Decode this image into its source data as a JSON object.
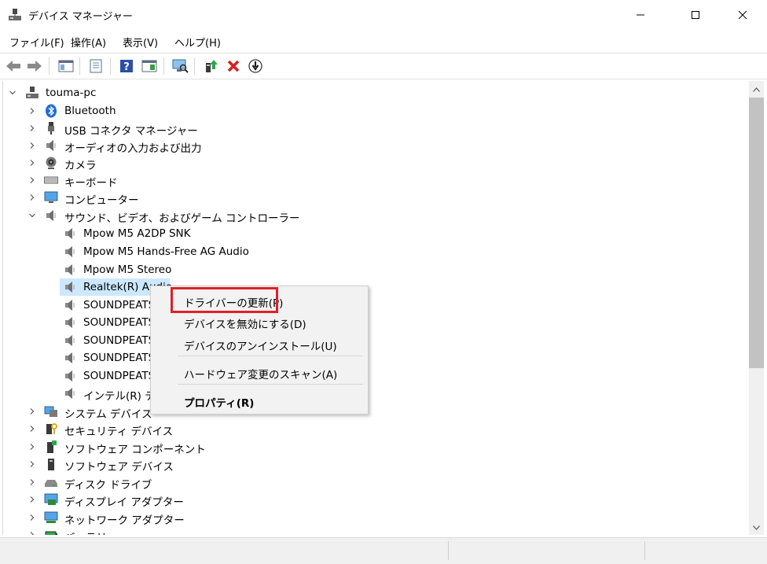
{
  "window": {
    "title": "デバイス マネージャー"
  },
  "menu": [
    "ファイル(F)",
    "操作(A)",
    "表示(V)",
    "ヘルプ(H)"
  ],
  "toolbar_icons": [
    "back-icon",
    "forward-icon",
    "show-hide-console-tree-icon",
    "properties-icon",
    "help-icon",
    "action-pane-icon",
    "scan-hardware-icon",
    "update-driver-icon",
    "uninstall-device-icon",
    "disable-device-icon"
  ],
  "tree": {
    "root": "touma-pc",
    "categories": [
      "Bluetooth",
      "USB コネクタ マネージャー",
      "オーディオの入力および出力",
      "カメラ",
      "キーボード",
      "コンピューター",
      "サウンド、ビデオ、およびゲーム コントローラー"
    ],
    "sound_children": [
      "Mpow M5 A2DP SNK",
      "Mpow M5 Hands-Free AG Audio",
      "Mpow M5 Stereo",
      "Realtek(R) Audio",
      "SOUNDPEATS",
      "SOUNDPEATS",
      "SOUNDPEATS",
      "SOUNDPEATS",
      "SOUNDPEATS",
      "インテル(R) ディ"
    ],
    "more_categories": [
      "システム デバイス",
      "セキュリティ デバイス",
      "ソフトウェア コンポーネント",
      "ソフトウェア デバイス",
      "ディスク ドライブ",
      "ディスプレイ アダプター",
      "ネットワーク アダプター",
      "バッテリ"
    ]
  },
  "context_menu": {
    "update_driver": "ドライバーの更新(P)",
    "disable_device": "デバイスを無効にする(D)",
    "uninstall_device": "デバイスのアンインストール(U)",
    "scan_hardware": "ハードウェア変更のスキャン(A)",
    "properties": "プロパティ(R)"
  },
  "colors": {
    "selection": "#cce8ff",
    "highlight_box": "#e0202a",
    "menu_bg": "#f2f2f2"
  }
}
